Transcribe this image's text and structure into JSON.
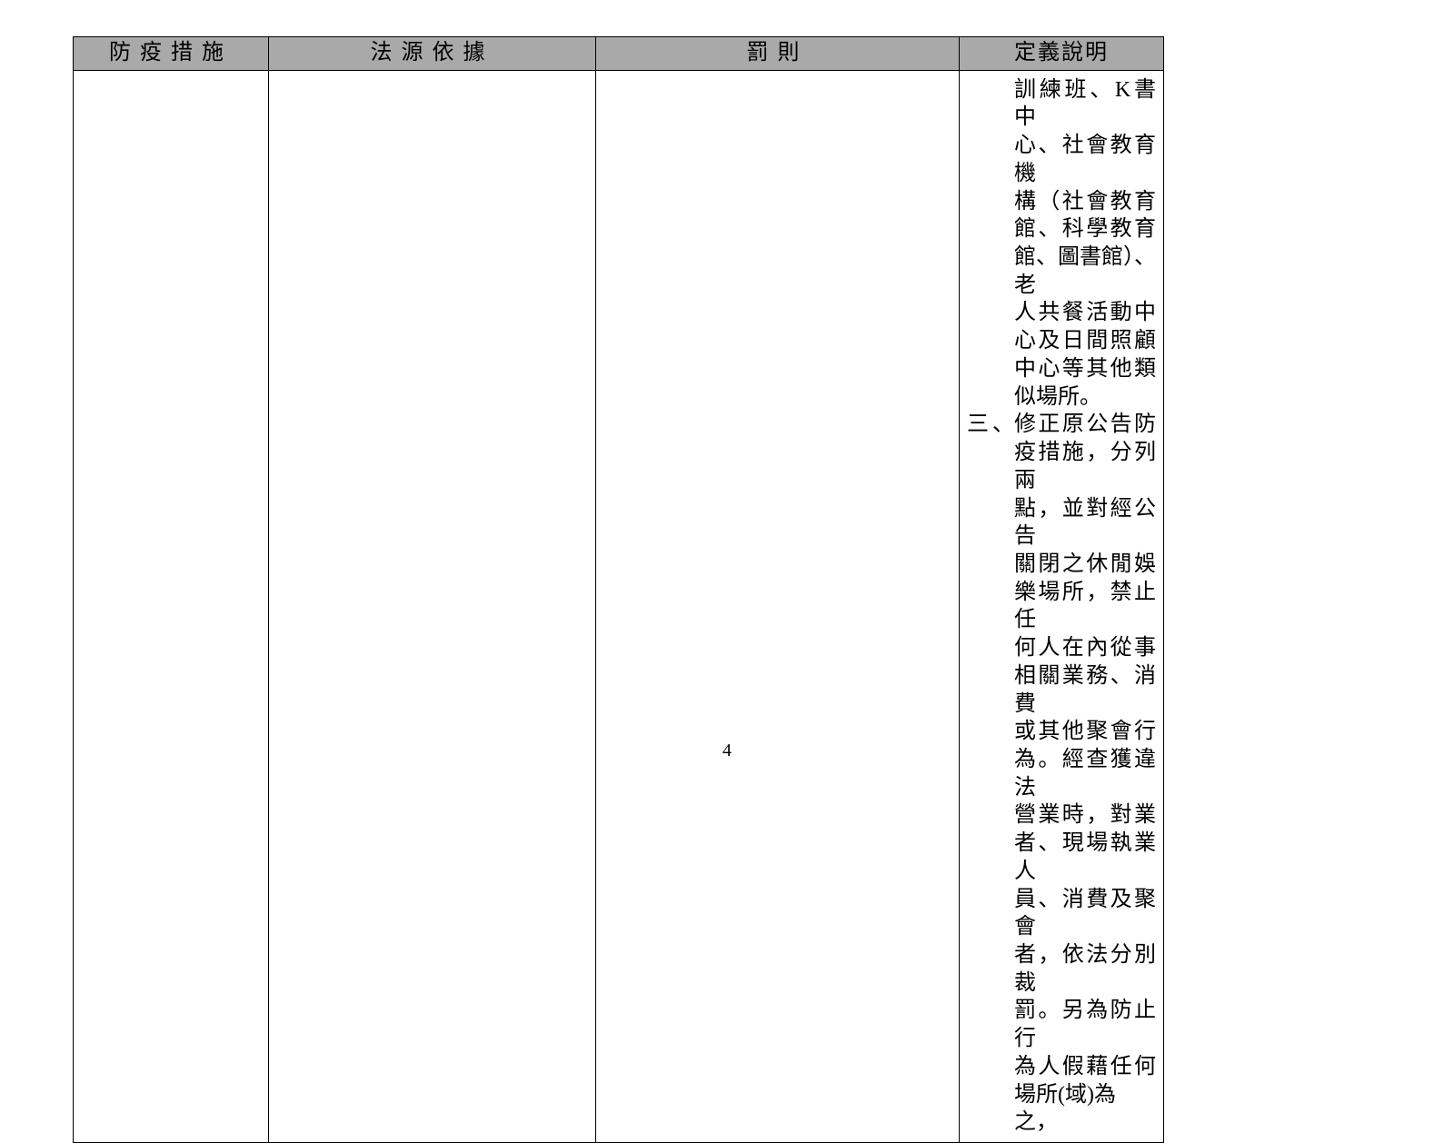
{
  "page_number": "4",
  "table": {
    "headers": [
      "防疫措施",
      "法源依據",
      "罰則",
      "定義說明"
    ],
    "body": {
      "col0": "",
      "col1": "",
      "col2": "",
      "col3": {
        "block1_lines": [
          "訓練班、K書中",
          "心、社會教育機",
          "構（社會教育",
          "館、科學教育",
          "館、圖書館）、老",
          "人共餐活動中",
          "心及日間照顧",
          "中心等其他類"
        ],
        "block1_last_line": "似場所。",
        "item3_number": "三、",
        "item3_lines": [
          "修正原公告防",
          "疫措施，分列兩",
          "點，並對經公告",
          "關閉之休閒娛",
          "樂場所，禁止任",
          "何人在內從事",
          "相關業務、消費",
          "或其他聚會行",
          "為。經查獲違法",
          "營業時，對業",
          "者、現場執業人",
          "員、消費及聚會",
          "者，依法分別裁",
          "罰。另為防止行",
          "為人假藉任何",
          "場所(域)為之，"
        ]
      }
    }
  }
}
